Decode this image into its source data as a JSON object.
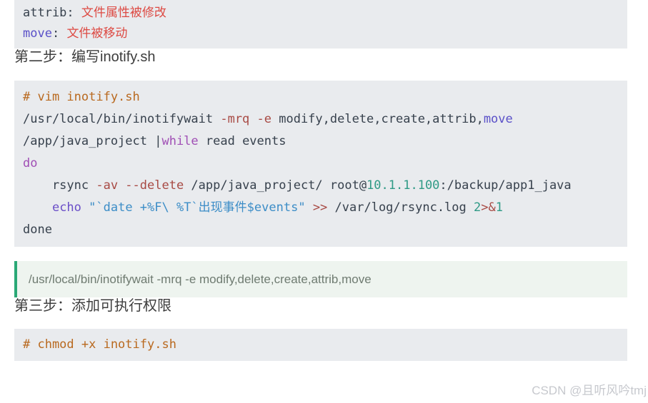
{
  "colors": {
    "page_background": "#ffffff",
    "code_background": "#e9ebee",
    "code_text": "#37414d",
    "comment_orange": "#b9691f",
    "keyword_purple": "#a04fb5",
    "builtin_purple": "#6b4fc8",
    "indigo": "#5a50c8",
    "string_blue": "#3c8dc7",
    "flag_red": "#a84a44",
    "number_teal": "#2f9a86",
    "cjk_red": "#dd4a43",
    "quote_background": "#eef4ef",
    "quote_border_green": "#2aa876",
    "quote_text_gray": "#6f7b71",
    "heading_text": "#3d3d3d",
    "watermark_gray": "#c7c9ce"
  },
  "headings": {
    "step2": "第二步：编写inotify.sh",
    "step3": "第三步：添加可执行权限"
  },
  "event_block": {
    "lines": [
      [
        {
          "t": "attrib: ",
          "c": "t-plain"
        },
        {
          "t": "文件属性被修改",
          "c": "t-red"
        }
      ],
      [
        {
          "t": "move",
          "c": "t-ind"
        },
        {
          "t": ": ",
          "c": "t-plain"
        },
        {
          "t": "文件被移动",
          "c": "t-red"
        }
      ]
    ]
  },
  "inotify_block": {
    "lines": [
      [
        {
          "t": "# vim inotify.sh",
          "c": "t-comment"
        }
      ],
      [
        {
          "t": "/usr/local/bin/inotifywait ",
          "c": "t-plain"
        },
        {
          "t": "-mrq -e",
          "c": "t-flag"
        },
        {
          "t": " modify,delete,create,attrib,",
          "c": "t-plain"
        },
        {
          "t": "move",
          "c": "t-ind"
        }
      ],
      [
        {
          "t": "/app/java_project |",
          "c": "t-plain"
        },
        {
          "t": "while",
          "c": "t-kw"
        },
        {
          "t": " read events",
          "c": "t-plain"
        }
      ],
      [
        {
          "t": "do",
          "c": "t-kw"
        }
      ],
      [
        {
          "t": "    rsync ",
          "c": "t-plain"
        },
        {
          "t": "-av --delete",
          "c": "t-flag"
        },
        {
          "t": " /app/java_project/ root@",
          "c": "t-plain"
        },
        {
          "t": "10.1.1.100",
          "c": "t-num"
        },
        {
          "t": ":/backup/app1_java",
          "c": "t-plain"
        }
      ],
      [
        {
          "t": "    ",
          "c": "t-plain"
        },
        {
          "t": "echo",
          "c": "t-echo"
        },
        {
          "t": " ",
          "c": "t-plain"
        },
        {
          "t": "\"`date +%F\\ %T`出现事件$events\"",
          "c": "t-str"
        },
        {
          "t": " ",
          "c": "t-plain"
        },
        {
          "t": ">>",
          "c": "t-flag"
        },
        {
          "t": " /var/log/rsync.log ",
          "c": "t-plain"
        },
        {
          "t": "2",
          "c": "t-num"
        },
        {
          "t": ">&",
          "c": "t-flag"
        },
        {
          "t": "1",
          "c": "t-num"
        }
      ],
      [
        {
          "t": "done",
          "c": "t-plain"
        }
      ]
    ]
  },
  "quote": {
    "text": "/usr/local/bin/inotifywait -mrq -e modify,delete,create,attrib,move"
  },
  "chmod_block": {
    "lines": [
      [
        {
          "t": "# chmod +x inotify.sh",
          "c": "t-comment"
        }
      ]
    ]
  },
  "watermark": {
    "text": "CSDN @且听风吟tmj"
  }
}
